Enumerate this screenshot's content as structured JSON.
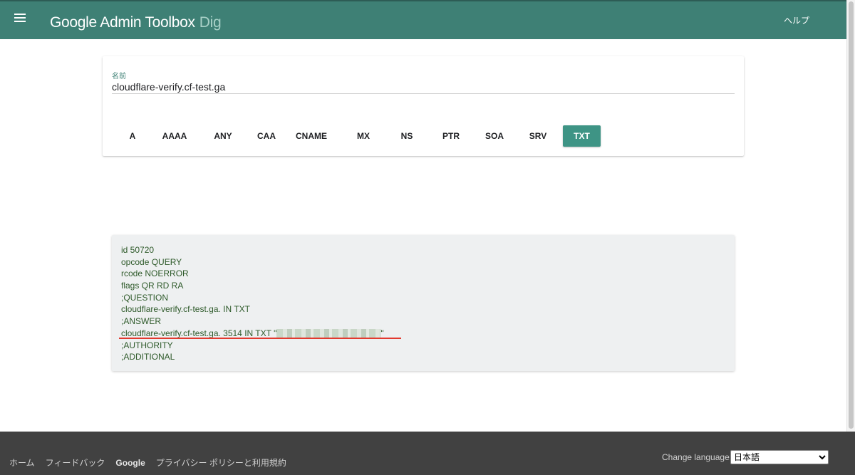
{
  "header": {
    "brand": "Google Admin Toolbox",
    "tool": "Dig",
    "help": "ヘルプ",
    "color": "#3e8075"
  },
  "query": {
    "name_label": "名前",
    "name_value": "cloudflare-verify.cf-test.ga",
    "record_types": [
      "A",
      "AAAA",
      "ANY",
      "CAA",
      "CNAME",
      "MX",
      "NS",
      "PTR",
      "SOA",
      "SRV",
      "TXT"
    ],
    "selected_type": "TXT",
    "accent": "#3e9485"
  },
  "result": {
    "lines": [
      "id 50720",
      "opcode QUERY",
      "rcode NOERROR",
      "flags QR RD RA",
      ";QUESTION",
      "cloudflare-verify.cf-test.ga. IN TXT",
      ";ANSWER",
      "cloudflare-verify.cf-test.ga. 3514 IN TXT \"",
      ";AUTHORITY",
      ";ADDITIONAL"
    ],
    "redacted_line_index": 7,
    "redacted_suffix": "\"",
    "text_color": "#2e5a2a",
    "underline_color": "#e23a2f"
  },
  "footer": {
    "links": [
      "ホーム",
      "フィードバック",
      "Google",
      "プライバシー ポリシーと利用規約"
    ],
    "language_label": "Change language:",
    "language_selected": "日本語"
  }
}
